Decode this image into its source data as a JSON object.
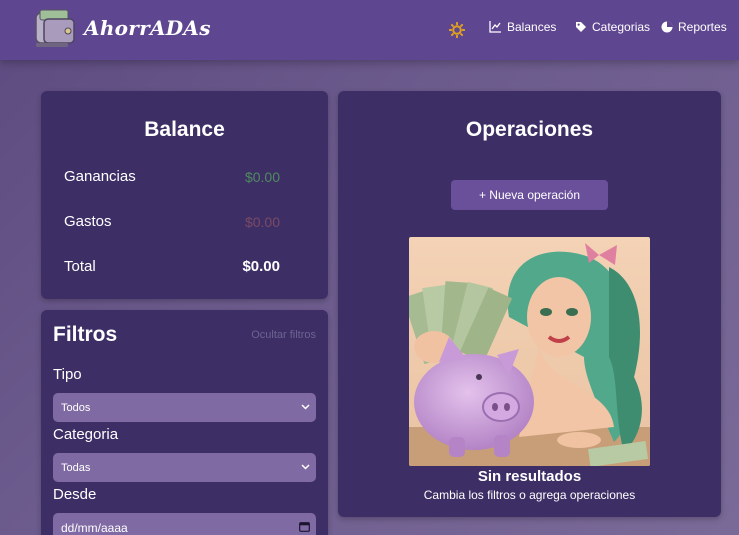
{
  "header": {
    "brand": "AhorrADAs",
    "nav": [
      {
        "label": "Balances",
        "icon": "chart-icon"
      },
      {
        "label": "Categorias",
        "icon": "tag-icon"
      },
      {
        "label": "Reportes",
        "icon": "pie-chart-icon"
      }
    ],
    "theme_icon": "sun-icon"
  },
  "balance": {
    "title": "Balance",
    "rows": [
      {
        "label": "Ganancias",
        "value": "$0.00",
        "color": "#4f8a5e"
      },
      {
        "label": "Gastos",
        "value": "$0.00",
        "color": "#7a4a64"
      },
      {
        "label": "Total",
        "value": "$0.00",
        "color": "#ffffff"
      }
    ]
  },
  "operations": {
    "title": "Operaciones",
    "new_button": "+ Nueva operación",
    "empty_title": "Sin resultados",
    "empty_subtitle": "Cambia los filtros o agrega operaciones"
  },
  "filters": {
    "title": "Filtros",
    "hide_link": "Ocultar filtros",
    "type_label": "Tipo",
    "type_value": "Todos",
    "category_label": "Categoria",
    "category_value": "Todas",
    "from_label": "Desde",
    "from_placeholder": "dd/mm/aaaa"
  },
  "colors": {
    "navbar": "#5e4690",
    "card": "#3d2f66",
    "accent_button": "#6a4f9a",
    "select": "#7f6aa3",
    "sun": "#e0a020"
  }
}
